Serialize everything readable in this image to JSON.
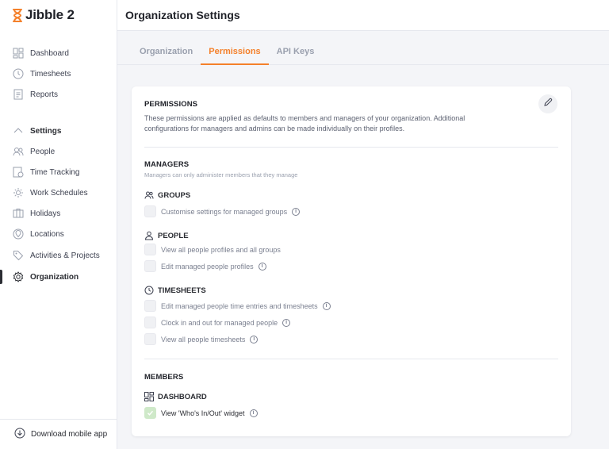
{
  "app": {
    "name": "Jibble 2"
  },
  "sidebar": {
    "items": [
      {
        "label": "Dashboard",
        "icon": "dashboard-icon"
      },
      {
        "label": "Timesheets",
        "icon": "clock-icon"
      },
      {
        "label": "Reports",
        "icon": "report-icon"
      },
      {
        "label": "Settings",
        "icon": "chevron-up-icon"
      },
      {
        "label": "People",
        "icon": "people-icon"
      },
      {
        "label": "Time Tracking",
        "icon": "time-tracking-icon"
      },
      {
        "label": "Work Schedules",
        "icon": "work-schedules-icon"
      },
      {
        "label": "Holidays",
        "icon": "holidays-icon"
      },
      {
        "label": "Locations",
        "icon": "location-pin-icon"
      },
      {
        "label": "Activities & Projects",
        "icon": "tag-icon"
      },
      {
        "label": "Organization",
        "icon": "gear-icon"
      }
    ],
    "download_label": "Download mobile app"
  },
  "header": {
    "title": "Organization Settings"
  },
  "tabs": [
    {
      "label": "Organization"
    },
    {
      "label": "Permissions"
    },
    {
      "label": "API Keys"
    }
  ],
  "permissions": {
    "title": "PERMISSIONS",
    "desc_line1": "These permissions are applied as defaults to members and managers of your organization. Additional",
    "desc_line2": "configurations for managers and admins can be made individually on their profiles."
  },
  "managers": {
    "title": "MANAGERS",
    "subtitle": "Managers can only administer members that they manage",
    "groups": {
      "title": "GROUPS",
      "options": [
        "Customise settings for managed groups"
      ]
    },
    "people": {
      "title": "PEOPLE",
      "options": [
        "View all people profiles and all groups",
        "Edit managed people profiles"
      ]
    },
    "timesheets": {
      "title": "TIMESHEETS",
      "options": [
        "Edit managed people time entries and timesheets",
        "Clock in and out for managed people",
        "View all people timesheets"
      ]
    }
  },
  "members": {
    "title": "MEMBERS",
    "dashboard": {
      "title": "DASHBOARD",
      "options": [
        "View 'Who's In/Out' widget"
      ]
    }
  },
  "colors": {
    "accent": "#f4802a",
    "checked": "#cfe9c9"
  }
}
